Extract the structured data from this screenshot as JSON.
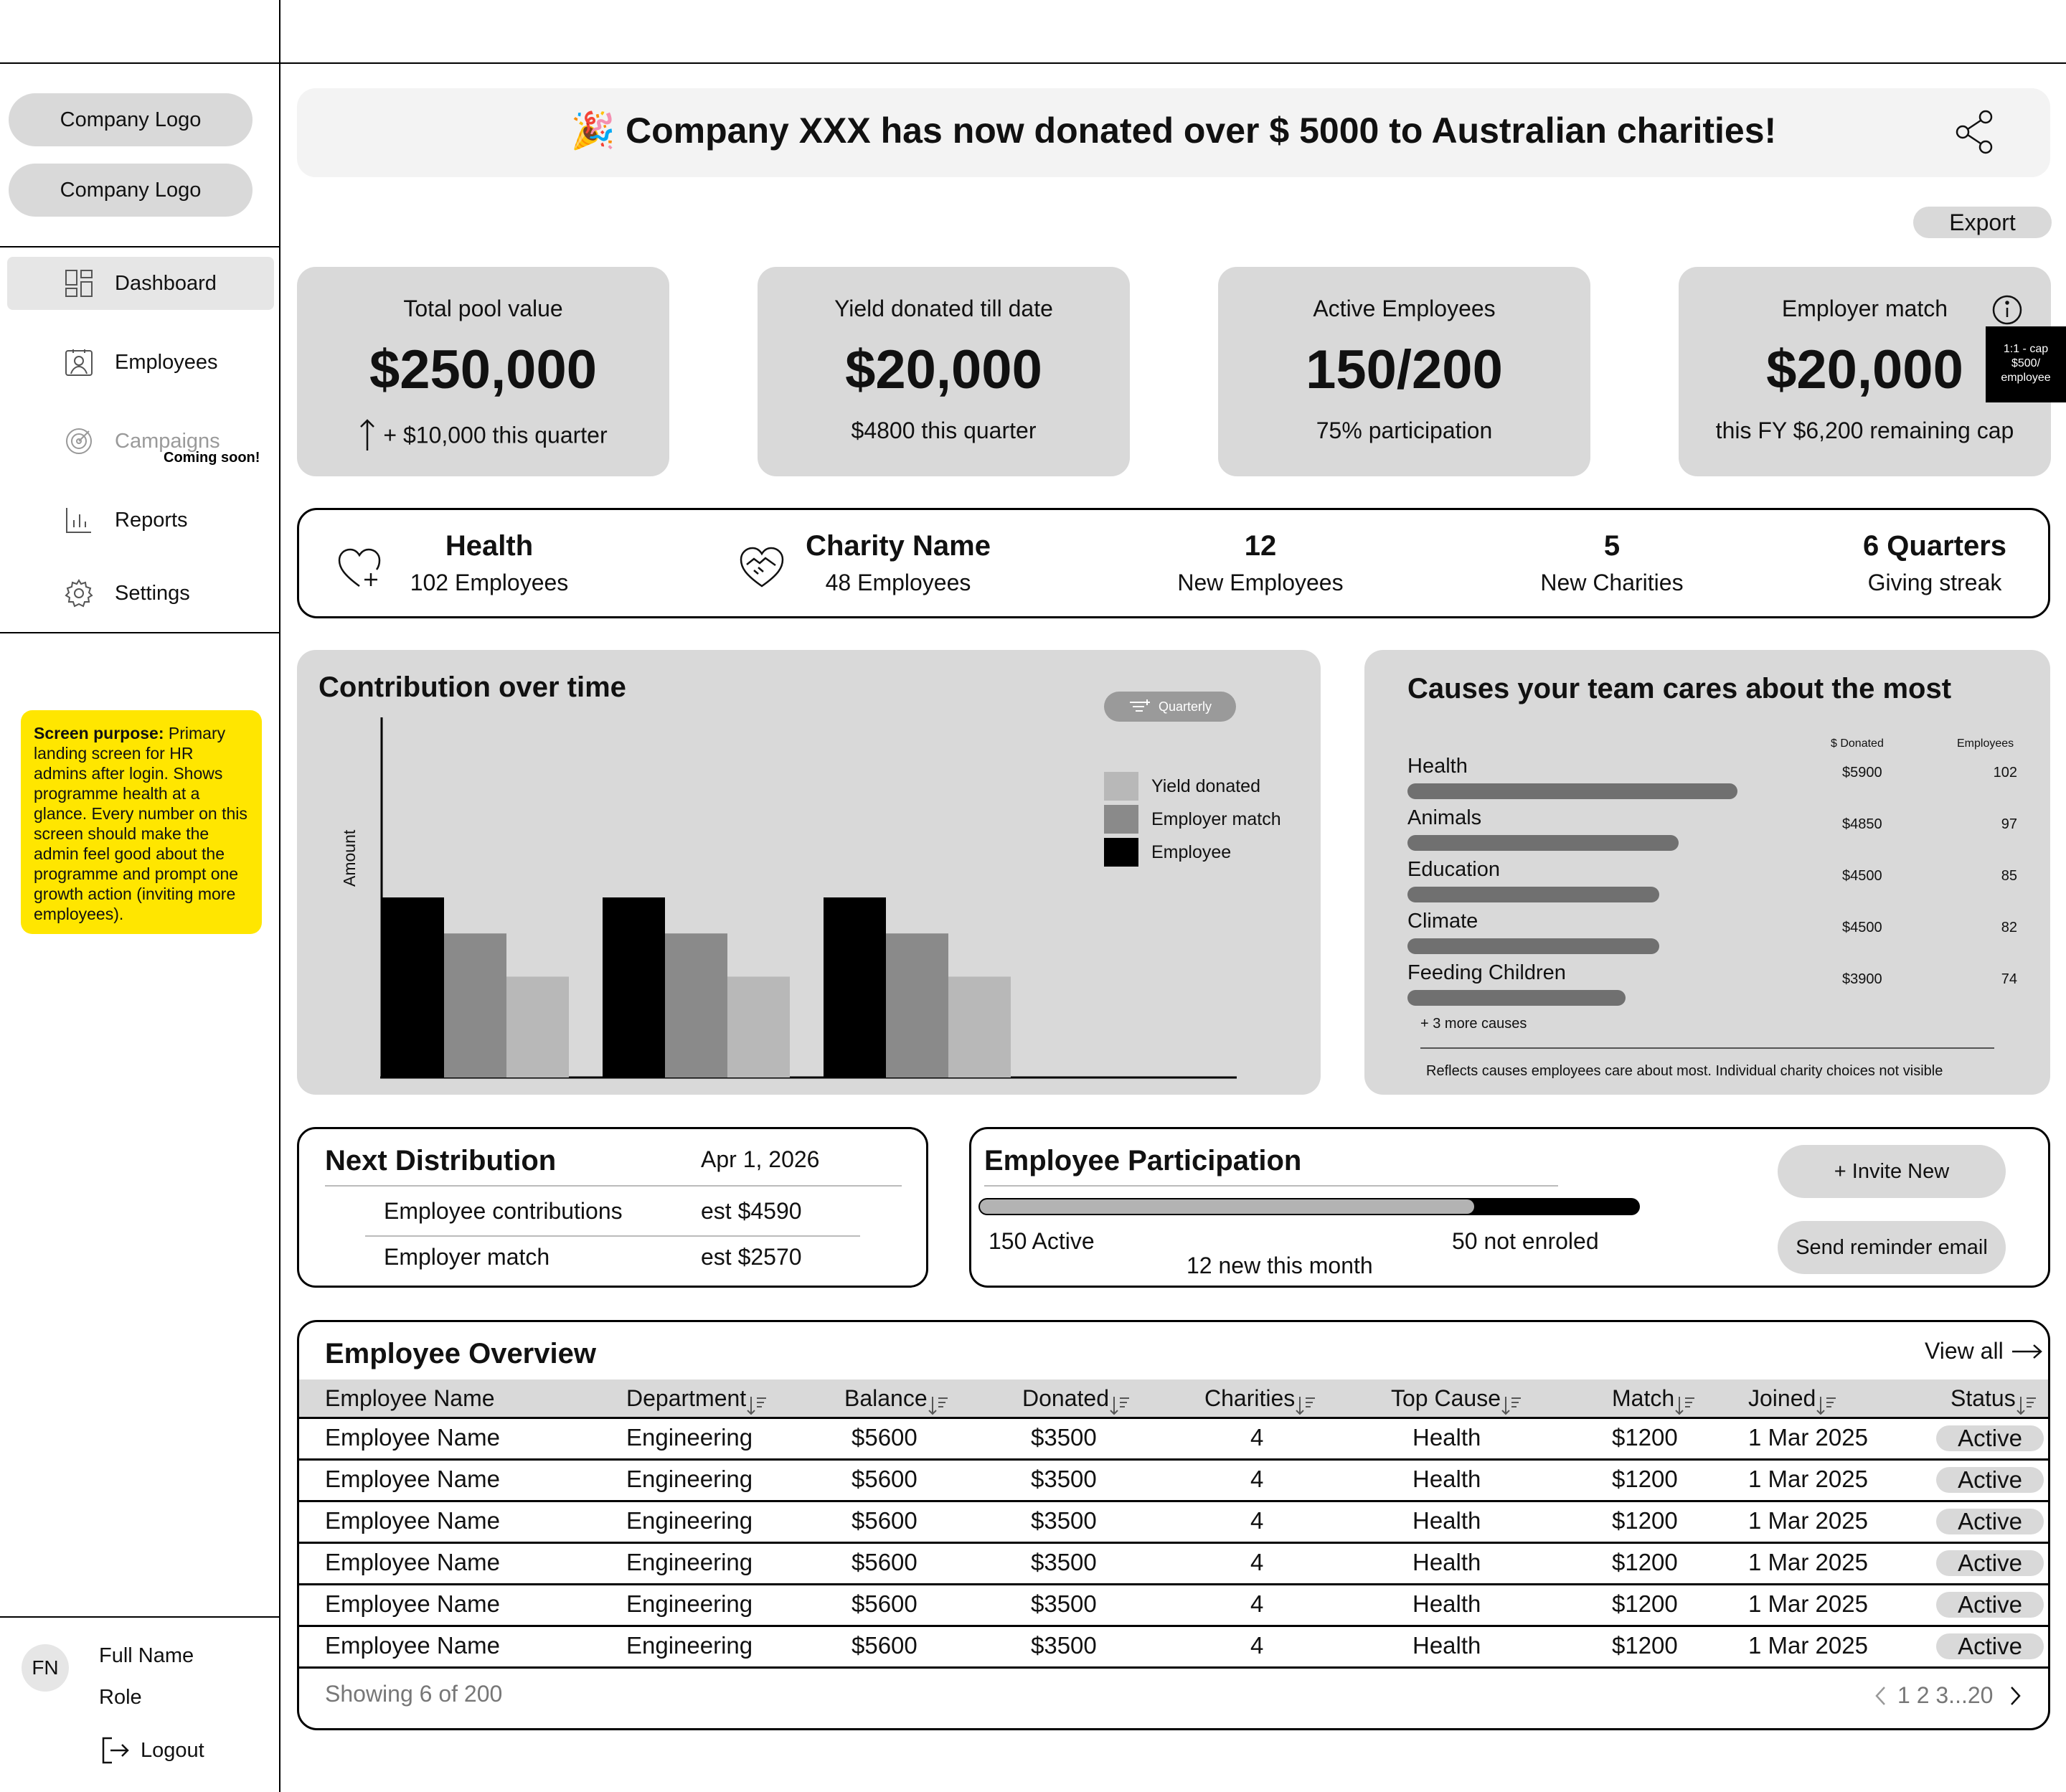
{
  "sidebar": {
    "logos": [
      "Company Logo",
      "Company Logo"
    ],
    "items": [
      {
        "label": "Dashboard",
        "icon": "dashboard-icon",
        "active": true
      },
      {
        "label": "Employees",
        "icon": "employees-icon",
        "active": false
      },
      {
        "label": "Campaigns",
        "icon": "campaigns-icon",
        "active": false,
        "badge": "Coming soon!"
      },
      {
        "label": "Reports",
        "icon": "reports-icon",
        "active": false
      },
      {
        "label": "Settings",
        "icon": "settings-icon",
        "active": false
      }
    ],
    "note": {
      "title": "Screen purpose:",
      "body": "Primary landing screen for HR admins after login. Shows programme health at a glance. Every number on this screen should make the admin feel good about the programme and prompt one growth action (inviting more employees)."
    },
    "user": {
      "initials": "FN",
      "name": "Full Name",
      "role": "Role",
      "logout": "Logout"
    }
  },
  "banner": {
    "emoji": "🎉",
    "text": "Company XXX has now donated over $ 5000 to Australian charities!"
  },
  "export_label": "Export",
  "kpis": [
    {
      "label": "Total pool value",
      "value": "$250,000",
      "sub": "+ $10,000 this quarter",
      "trend": "up-arrow-icon"
    },
    {
      "label": "Yield donated till date",
      "value": "$20,000",
      "sub": "$4800 this quarter"
    },
    {
      "label": "Active Employees",
      "value": "150/200",
      "sub": "75% participation"
    },
    {
      "label": "Employer match",
      "value": "$20,000",
      "sub": "this FY $6,200 remaining cap",
      "tooltip": "1:1 - cap $500/ employee"
    }
  ],
  "strip": [
    {
      "big": "Health",
      "small": "102 Employees",
      "icon": "heart-plus-icon"
    },
    {
      "big": "Charity Name",
      "small": "48 Employees",
      "icon": "handshake-heart-icon"
    },
    {
      "big": "12",
      "small": "New Employees"
    },
    {
      "big": "5",
      "small": "New Charities"
    },
    {
      "big": "6 Quarters",
      "small": "Giving streak"
    }
  ],
  "contribution": {
    "title": "Contribution over time",
    "filter_label": "Quarterly"
  },
  "chart_data": {
    "type": "bar",
    "title": "Contribution over time",
    "ylabel": "Amount",
    "xlabel": "",
    "categories": [
      "",
      "",
      ""
    ],
    "series": [
      {
        "name": "Employee",
        "color": "#000000",
        "values": [
          100,
          100,
          100
        ]
      },
      {
        "name": "Employer match",
        "color": "#8a8a8a",
        "values": [
          80,
          80,
          80
        ]
      },
      {
        "name": "Yield donated",
        "color": "#b8b8b8",
        "values": [
          56,
          56,
          56
        ]
      }
    ],
    "legend_order": [
      "Yield donated",
      "Employer match",
      "Employee"
    ],
    "ylim": [
      0,
      200
    ],
    "legend": "right",
    "grid": false
  },
  "causes": {
    "title": "Causes your team cares about the most",
    "col_donated": "$ Donated",
    "col_employees": "Employees",
    "rows": [
      {
        "name": "Health",
        "donated": "$5900",
        "employees": "102",
        "value": 5900
      },
      {
        "name": "Animals",
        "donated": "$4850",
        "employees": "97",
        "value": 4850
      },
      {
        "name": "Education",
        "donated": "$4500",
        "employees": "85",
        "value": 4500
      },
      {
        "name": "Climate",
        "donated": "$4500",
        "employees": "82",
        "value": 4500
      },
      {
        "name": "Feeding Children",
        "donated": "$3900",
        "employees": "74",
        "value": 3900
      }
    ],
    "more": "+ 3 more causes",
    "footnote": "Reflects causes employees care about most. Individual charity choices not visible"
  },
  "distribution": {
    "title": "Next Distribution",
    "date": "Apr 1, 2026",
    "rows": [
      {
        "label": "Employee contributions",
        "value": "est $4590"
      },
      {
        "label": "Employer match",
        "value": "est $2570"
      }
    ]
  },
  "participation": {
    "title": "Employee Participation",
    "active_label": "150 Active",
    "not_label": "50 not enroled",
    "new_label": "12 new this month",
    "active_fraction": 0.75,
    "invite_label": "+ Invite New",
    "reminder_label": "Send reminder email"
  },
  "overview": {
    "title": "Employee Overview",
    "view_all": "View all",
    "columns": [
      "Employee Name",
      "Department",
      "Balance",
      "Donated",
      "Charities",
      "Top Cause",
      "Match",
      "Joined",
      "Status"
    ],
    "rows": [
      [
        "Employee Name",
        "Engineering",
        "$5600",
        "$3500",
        "4",
        "Health",
        "$1200",
        "1 Mar 2025",
        "Active"
      ],
      [
        "Employee Name",
        "Engineering",
        "$5600",
        "$3500",
        "4",
        "Health",
        "$1200",
        "1 Mar 2025",
        "Active"
      ],
      [
        "Employee Name",
        "Engineering",
        "$5600",
        "$3500",
        "4",
        "Health",
        "$1200",
        "1 Mar 2025",
        "Active"
      ],
      [
        "Employee Name",
        "Engineering",
        "$5600",
        "$3500",
        "4",
        "Health",
        "$1200",
        "1 Mar 2025",
        "Active"
      ],
      [
        "Employee Name",
        "Engineering",
        "$5600",
        "$3500",
        "4",
        "Health",
        "$1200",
        "1 Mar 2025",
        "Active"
      ],
      [
        "Employee Name",
        "Engineering",
        "$5600",
        "$3500",
        "4",
        "Health",
        "$1200",
        "1 Mar 2025",
        "Active"
      ]
    ],
    "showing": "Showing 6 of 200",
    "pages": "1 2 3...20"
  }
}
